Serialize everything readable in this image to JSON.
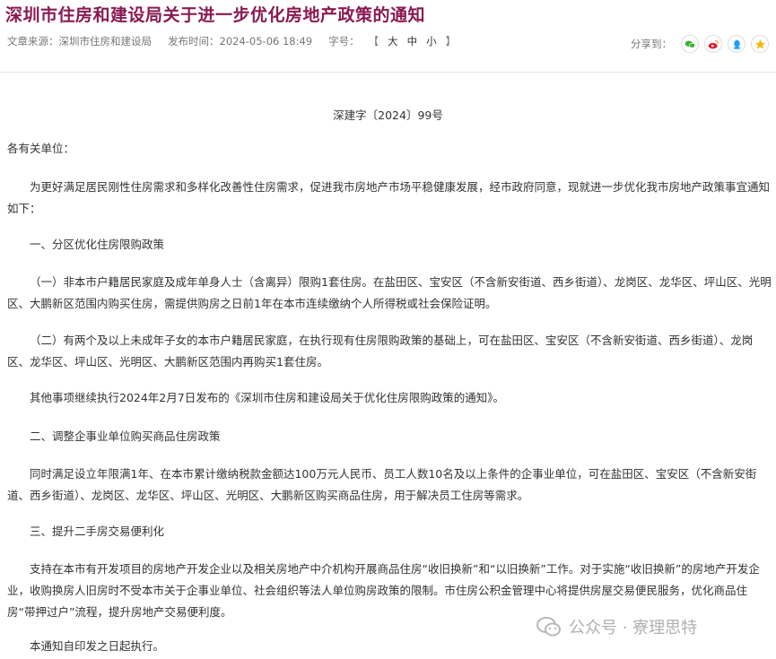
{
  "article": {
    "title": "深圳市住房和建设局关于进一步优化房地产政策的通知",
    "meta": {
      "source": "文章来源：深圳市住房和建设局",
      "publish_time": "发布时间：2024-05-06 18:49",
      "font_size_label": "字号：",
      "font_open": "【",
      "font_large": "大",
      "font_medium": "中",
      "font_small": "小",
      "font_close": "】"
    },
    "share": {
      "label": "分享到：",
      "icons": [
        "wechat-icon",
        "weibo-icon",
        "qq-icon",
        "qzone-icon"
      ]
    },
    "doc_number": "深建字〔2024〕99号",
    "salutation": "各有关单位：",
    "paragraphs": [
      "为更好满足居民刚性住房需求和多样化改善性住房需求，促进我市房地产市场平稳健康发展，经市政府同意，现就进一步优化我市房地产政策事宜通知如下：",
      "一、分区优化住房限购政策",
      "（一）非本市户籍居民家庭及成年单身人士（含离异）限购1套住房。在盐田区、宝安区（不含新安街道、西乡街道）、龙岗区、龙华区、坪山区、光明区、大鹏新区范围内购买住房，需提供购房之日前1年在本市连续缴纳个人所得税或社会保险证明。",
      "（二）有两个及以上未成年子女的本市户籍居民家庭，在执行现有住房限购政策的基础上，可在盐田区、宝安区（不含新安街道、西乡街道）、龙岗区、龙华区、坪山区、光明区、大鹏新区范围内再购买1套住房。",
      "其他事项继续执行2024年2月7日发布的《深圳市住房和建设局关于优化住房限购政策的通知》。",
      "二、调整企事业单位购买商品住房政策",
      "同时满足设立年限满1年、在本市累计缴纳税款金额达100万元人民币、员工人数10名及以上条件的企事业单位，可在盐田区、宝安区（不含新安街道、西乡街道）、龙岗区、龙华区、坪山区、光明区、大鹏新区购买商品住房，用于解决员工住房等需求。",
      "三、提升二手房交易便利化",
      "支持在本市有开发项目的房地产开发企业以及相关房地产中介机构开展商品住房“收旧换新”和“以旧换新”工作。对于实施“收旧换新”的房地产开发企业，收购换房人旧房时不受本市关于企事业单位、社会组织等法人单位购房政策的限制。市住房公积金管理中心将提供房屋交易便民服务，优化商品住房“带押过户”流程，提升房地产交易便利度。",
      "本通知自印发之日起执行。"
    ]
  },
  "watermark": {
    "text": "公众号 · 寮理思特",
    "icon": "wechat-official-account-icon"
  },
  "colors": {
    "title": "#8a1a52",
    "text": "#333333",
    "meta": "#777777",
    "wechat": "#3cb034",
    "weibo": "#e6162d",
    "qq": "#1e9fff",
    "qzone": "#f5b800"
  }
}
